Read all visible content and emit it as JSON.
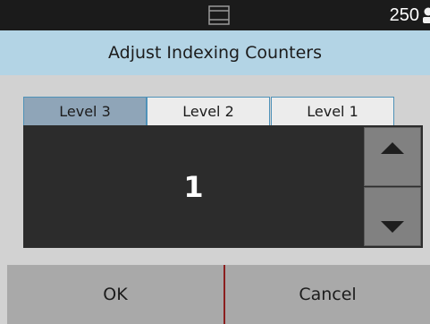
{
  "status_bar": {
    "sheet_count": "250",
    "tray_icon": "output-tray-icon",
    "user_icon": "user-icon"
  },
  "dialog": {
    "title": "Adjust Indexing Counters"
  },
  "tabs": [
    {
      "label": "Level 3",
      "active": true
    },
    {
      "label": "Level 2",
      "active": false
    },
    {
      "label": "Level 1",
      "active": false
    }
  ],
  "counter": {
    "value": "1",
    "up_icon": "arrow-up-icon",
    "down_icon": "arrow-down-icon"
  },
  "buttons": {
    "ok_label": "OK",
    "cancel_label": "Cancel"
  },
  "colors": {
    "status_bar_bg": "#1b1b1b",
    "title_bg": "#b3d4e5",
    "content_bg": "#d2d2d2",
    "counter_bg": "#2c2c2c",
    "active_tab_bg": "#8fa5b8",
    "tab_border": "#4f92b8",
    "stepper_bg": "#818181",
    "button_bg": "#a9a9a9"
  }
}
